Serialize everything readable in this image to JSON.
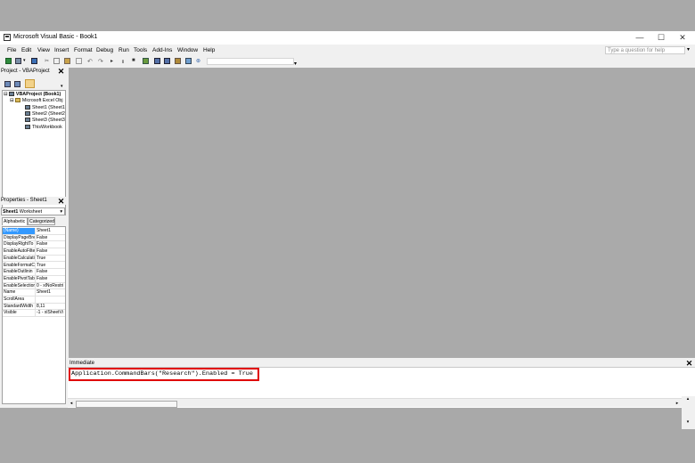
{
  "window": {
    "title": "Microsoft Visual Basic - Book1",
    "controls": {
      "minimize": "—",
      "maximize": "☐",
      "close": "✕"
    }
  },
  "menu": {
    "items": [
      "File",
      "Edit",
      "View",
      "Insert",
      "Format",
      "Debug",
      "Run",
      "Tools",
      "Add-Ins",
      "Window",
      "Help"
    ],
    "help_placeholder": "Type a question for help"
  },
  "project": {
    "title": "Project - VBAProject",
    "root": "VBAProject (Book1)",
    "folder": "Microsoft Excel Obj",
    "items": [
      "Sheet1 (Sheet1",
      "Sheet2 (Sheet2",
      "Sheet3 (Sheet3",
      "ThisWorkbook"
    ]
  },
  "properties": {
    "title": "Properties - Sheet1",
    "object_name": "Sheet1",
    "object_type": "Worksheet",
    "tabs": [
      "Alphabetic",
      "Categorized"
    ],
    "rows": [
      {
        "name": "(Name)",
        "value": "Sheet1"
      },
      {
        "name": "DisplayPageBre",
        "value": "False"
      },
      {
        "name": "DisplayRightTo",
        "value": "False"
      },
      {
        "name": "EnableAutoFilte",
        "value": "False"
      },
      {
        "name": "EnableCalculati",
        "value": "True"
      },
      {
        "name": "EnableFormatC",
        "value": "True"
      },
      {
        "name": "EnableOutlinin",
        "value": "False"
      },
      {
        "name": "EnablePivotTab",
        "value": "False"
      },
      {
        "name": "EnableSelection",
        "value": "0 - xlNoRestri"
      },
      {
        "name": "Name",
        "value": "Sheet1"
      },
      {
        "name": "ScrollArea",
        "value": ""
      },
      {
        "name": "StandardWidth",
        "value": "8,11"
      },
      {
        "name": "Visible",
        "value": "-1 - xlSheetVi"
      }
    ]
  },
  "immediate": {
    "title": "Immediate",
    "code": "Application.CommandBars(\"Research\").Enabled = True"
  },
  "colors": {
    "highlight": "#e00000",
    "selection": "#3399ff"
  }
}
